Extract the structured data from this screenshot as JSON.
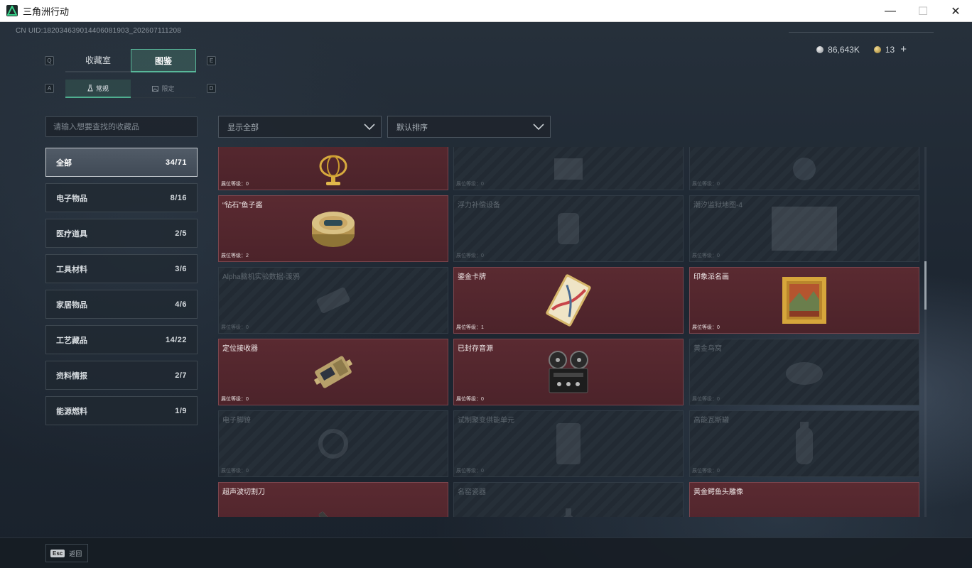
{
  "window": {
    "title": "三角洲行动",
    "minimize": "—",
    "maximize": "☐",
    "close": "✕"
  },
  "header": {
    "uid": "CN UID:18203463901440608190​3_202607111208",
    "currency": [
      {
        "icon": "silver-coin-icon",
        "value": "86,643K"
      },
      {
        "icon": "gold-coin-icon",
        "value": "13"
      }
    ],
    "add": "+"
  },
  "tabs": {
    "prev_key": "Q",
    "next_key": "E",
    "items": [
      {
        "label": "收藏室",
        "active": false
      },
      {
        "label": "图鉴",
        "active": true
      }
    ]
  },
  "subtabs": {
    "prev_key": "A",
    "next_key": "D",
    "items": [
      {
        "label": "常规",
        "icon": "flask-icon",
        "active": true
      },
      {
        "label": "限定",
        "icon": "image-icon",
        "active": false
      }
    ]
  },
  "search": {
    "placeholder": "请输入想要查找的收藏品"
  },
  "filters": {
    "show": "显示全部",
    "sort": "默认排序"
  },
  "categories": [
    {
      "label": "全部",
      "count": "34/71",
      "active": true
    },
    {
      "label": "电子物品",
      "count": "8/16",
      "active": false
    },
    {
      "label": "医疗道具",
      "count": "2/5",
      "active": false
    },
    {
      "label": "工具材料",
      "count": "3/6",
      "active": false
    },
    {
      "label": "家居物品",
      "count": "4/6",
      "active": false
    },
    {
      "label": "工艺藏品",
      "count": "14/22",
      "active": false
    },
    {
      "label": "资料情报",
      "count": "2/7",
      "active": false
    },
    {
      "label": "能源燃料",
      "count": "1/9",
      "active": false
    }
  ],
  "cards": [
    {
      "name": "",
      "level": "展位等级：0",
      "owned": true,
      "icon": "armillary-sphere-icon"
    },
    {
      "name": "",
      "level": "展位等级：0",
      "owned": false,
      "icon": "chessboard-icon"
    },
    {
      "name": "",
      "level": "展位等级：0",
      "owned": false,
      "icon": "robot-icon"
    },
    {
      "name": "“钻石”鱼子酱",
      "level": "展位等级：2",
      "owned": true,
      "icon": "caviar-tin-icon"
    },
    {
      "name": "浮力补偿设备",
      "level": "展位等级：0",
      "owned": false,
      "icon": "diving-vest-icon"
    },
    {
      "name": "潮汐监狱地图-4",
      "level": "展位等级：0",
      "owned": false,
      "icon": "map-icon"
    },
    {
      "name": "Alpha脑机实验数据-渡鸦",
      "level": "展位等级：0",
      "owned": false,
      "icon": "data-device-icon"
    },
    {
      "name": "鎏金卡牌",
      "level": "展位等级：1",
      "owned": true,
      "icon": "gilded-card-icon"
    },
    {
      "name": "印象派名画",
      "level": "展位等级：0",
      "owned": true,
      "icon": "painting-icon"
    },
    {
      "name": "定位接收器",
      "level": "展位等级：0",
      "owned": true,
      "icon": "receiver-icon"
    },
    {
      "name": "已封存音源",
      "level": "展位等级：0",
      "owned": true,
      "icon": "reel-recorder-icon"
    },
    {
      "name": "黄金鸟窝",
      "level": "展位等级：0",
      "owned": false,
      "icon": "bird-nest-icon"
    },
    {
      "name": "电子脚镣",
      "level": "展位等级：0",
      "owned": false,
      "icon": "ankle-monitor-icon"
    },
    {
      "name": "试制聚变供能单元",
      "level": "展位等级：0",
      "owned": false,
      "icon": "fusion-cell-icon"
    },
    {
      "name": "高能瓦斯罐",
      "level": "展位等级：0",
      "owned": false,
      "icon": "gas-canister-icon"
    },
    {
      "name": "超声波切割刀",
      "level": "",
      "owned": true,
      "icon": "cutter-icon"
    },
    {
      "name": "名窑瓷器",
      "level": "",
      "owned": false,
      "icon": "porcelain-icon"
    },
    {
      "name": "黄金鳄鱼头雕像",
      "level": "",
      "owned": true,
      "icon": "croc-head-icon"
    }
  ],
  "footer": {
    "esc_key": "Esc",
    "back": "返回"
  }
}
